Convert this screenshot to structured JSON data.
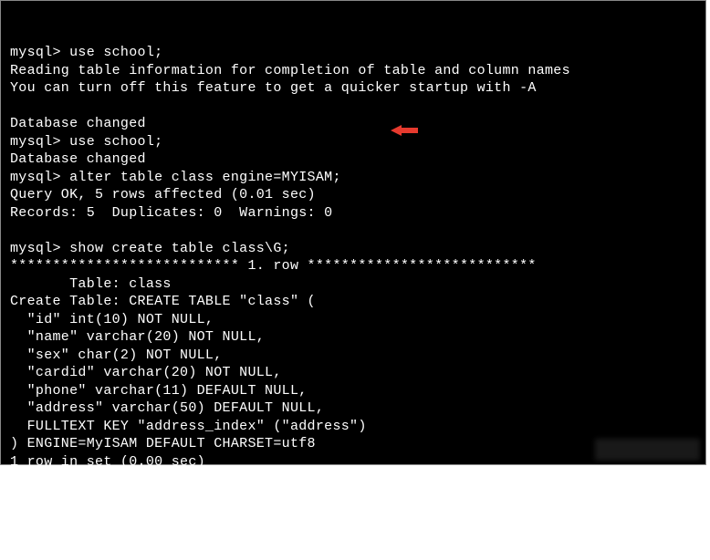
{
  "terminal": {
    "lines": [
      "mysql> use school;",
      "Reading table information for completion of table and column names",
      "You can turn off this feature to get a quicker startup with -A",
      "",
      "Database changed",
      "mysql> use school;",
      "Database changed",
      "mysql> alter table class engine=MYISAM;",
      "Query OK, 5 rows affected (0.01 sec)",
      "Records: 5  Duplicates: 0  Warnings: 0",
      "",
      "mysql> show create table class\\G;",
      "*************************** 1. row ***************************",
      "       Table: class",
      "Create Table: CREATE TABLE \"class\" (",
      "  \"id\" int(10) NOT NULL,",
      "  \"name\" varchar(20) NOT NULL,",
      "  \"sex\" char(2) NOT NULL,",
      "  \"cardid\" varchar(20) NOT NULL,",
      "  \"phone\" varchar(11) DEFAULT NULL,",
      "  \"address\" varchar(50) DEFAULT NULL,",
      "  FULLTEXT KEY \"address_index\" (\"address\")",
      ") ENGINE=MyISAM DEFAULT CHARSET=utf8",
      "1 row in set (0.00 sec)"
    ]
  },
  "annotation": {
    "arrow_color": "#e63a2e"
  }
}
